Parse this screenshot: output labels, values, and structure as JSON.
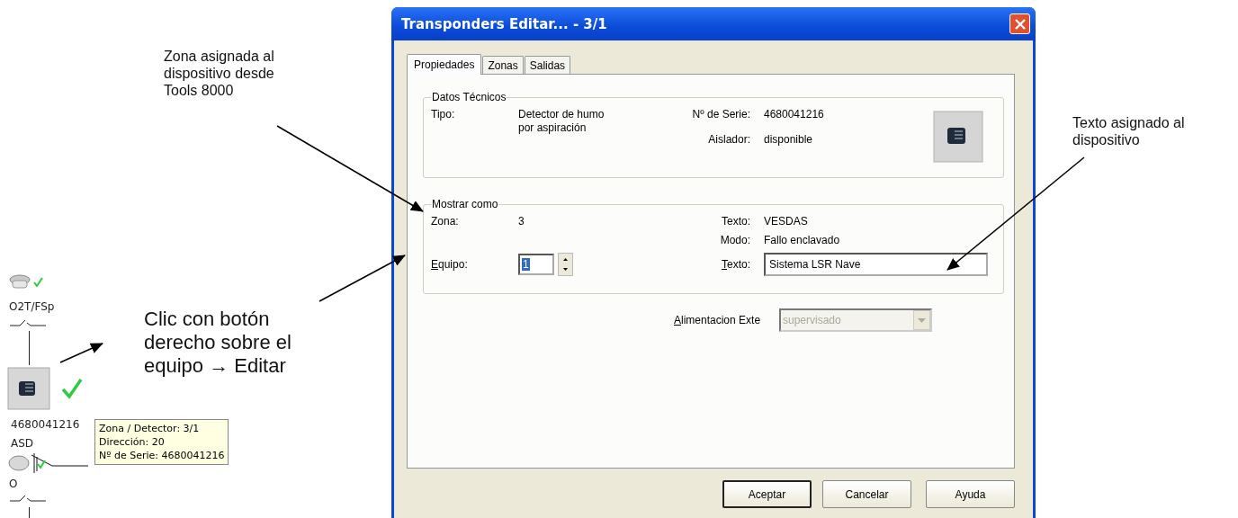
{
  "callouts": [
    {
      "kind": "zona",
      "lines": [
        "Zona asignada al",
        "dispositivo desde",
        "Tools 8000"
      ]
    },
    {
      "kind": "clic",
      "lines": [
        "Clic con botón",
        "derecho sobre el",
        "equipo → Editar"
      ]
    },
    {
      "kind": "texto",
      "lines": [
        "Texto asignado al",
        "dispositivo"
      ]
    }
  ],
  "diagram": {
    "top_label": "O2T/FSp",
    "serial": "4680041216",
    "type": "ASD",
    "bottom_label": "O",
    "tooltip": [
      "Zona / Detector: 3/1",
      "Dirección: 20",
      "Nº de Serie: 4680041216"
    ]
  },
  "dialog": {
    "title": "Transponders Editar... - 3/1",
    "tabs": [
      {
        "label": "Propiedades",
        "selected": true
      },
      {
        "label": "Zonas",
        "selected": false
      },
      {
        "label": "Salidas",
        "selected": false
      }
    ],
    "datos_tecnicos": {
      "legend": "Datos Técnicos",
      "tipo": {
        "label": "Tipo:",
        "value_lines": [
          "Detector de humo",
          "por aspiración"
        ]
      },
      "serie": {
        "label": "Nº de Serie:",
        "value": "4680041216"
      },
      "aislador": {
        "label": "Aislador:",
        "value": "disponible"
      }
    },
    "mostrar_como": {
      "legend": "Mostrar como",
      "zona": {
        "label": "Zona:",
        "value": "3"
      },
      "texto_info": {
        "label": "Texto:",
        "value": "VESDAS"
      },
      "modo": {
        "label": "Modo:",
        "value": "Fallo enclavado"
      },
      "equipo": {
        "label": "Equipo:",
        "value": "1"
      },
      "texto_field": {
        "label": "Texto:",
        "value": "Sistema LSR Nave"
      }
    },
    "alimentacion": {
      "label": "Alimentacion Exte",
      "value": "supervisado",
      "disabled": true
    },
    "buttons": [
      {
        "label": "Aceptar",
        "default": true
      },
      {
        "label": "Cancelar",
        "default": false
      },
      {
        "label": "Ayuda",
        "default": false
      }
    ]
  }
}
